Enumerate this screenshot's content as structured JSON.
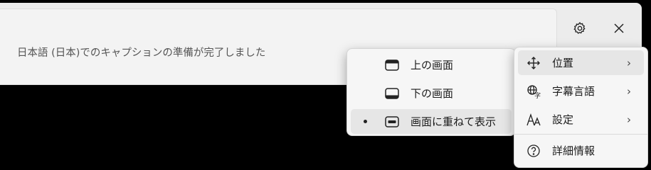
{
  "caption": {
    "status_text": "日本語 (日本)でのキャプションの準備が完了しました",
    "settings_icon": "gear-icon",
    "close_icon": "close-icon"
  },
  "position_submenu": {
    "items": [
      {
        "label": "上の画面",
        "icon": "dock-top-icon",
        "selected": false
      },
      {
        "label": "下の画面",
        "icon": "dock-bottom-icon",
        "selected": false
      },
      {
        "label": "画面に重ねて表示",
        "icon": "overlay-icon",
        "selected": true
      }
    ]
  },
  "settings_menu": {
    "items": [
      {
        "label": "位置",
        "icon": "move-icon",
        "has_submenu": true,
        "highlighted": true
      },
      {
        "label": "字幕言語",
        "icon": "language-icon",
        "has_submenu": true,
        "highlighted": false
      },
      {
        "label": "設定",
        "icon": "font-size-icon",
        "has_submenu": true,
        "highlighted": false
      },
      {
        "label": "詳細情報",
        "icon": "help-icon",
        "has_submenu": false,
        "highlighted": false
      }
    ],
    "chevron": "›"
  }
}
